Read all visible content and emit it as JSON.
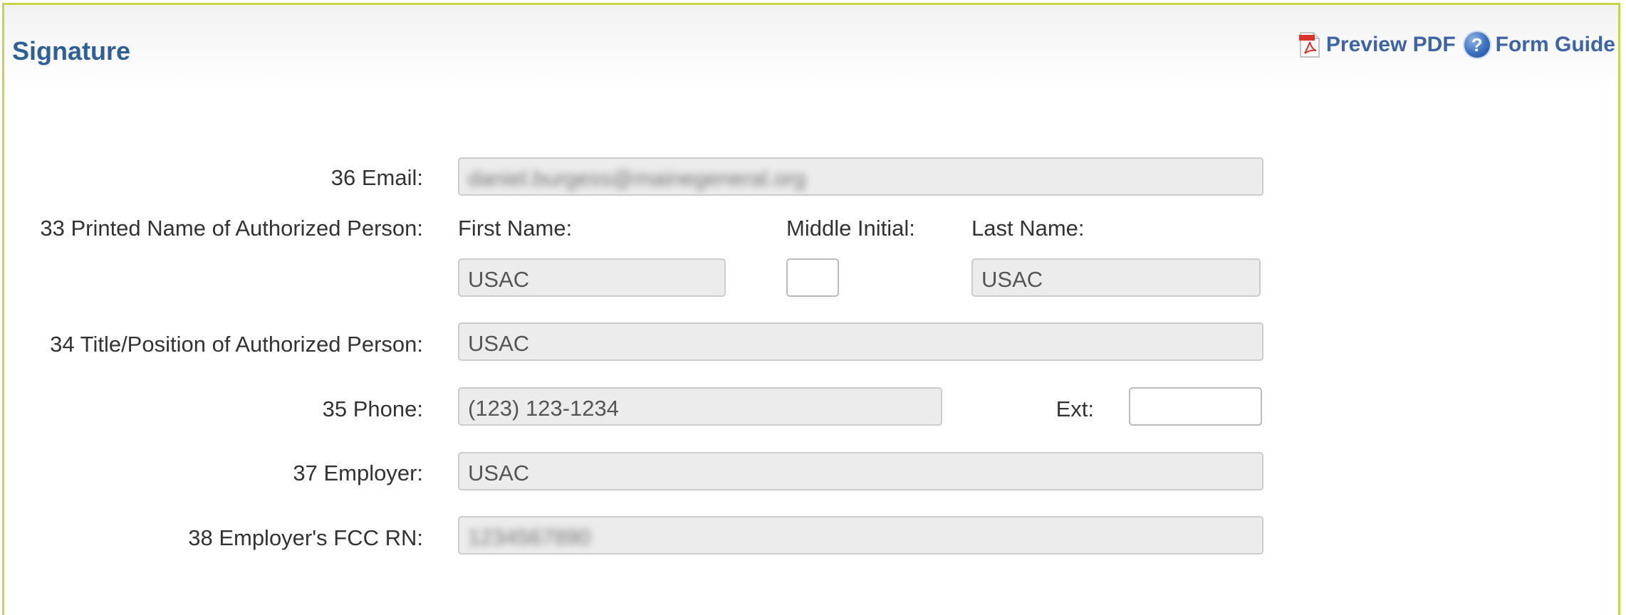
{
  "header": {
    "title": "Signature",
    "preview_pdf": "Preview PDF",
    "form_guide": "Form Guide",
    "help_icon_glyph": "?"
  },
  "form": {
    "email": {
      "label": "36 Email:",
      "value": "daniel.burgess@mainegeneral.org"
    },
    "printed_name": {
      "label": "33 Printed Name of Authorized Person:",
      "first_label": "First Name:",
      "middle_label": "Middle Initial:",
      "last_label": "Last Name:",
      "first_value": "USAC",
      "middle_value": "",
      "last_value": "USAC"
    },
    "title": {
      "label": "34 Title/Position of Authorized Person:",
      "value": "USAC"
    },
    "phone": {
      "label": "35 Phone:",
      "value": "(123) 123-1234",
      "ext_label": "Ext:",
      "ext_value": ""
    },
    "employer": {
      "label": "37 Employer:",
      "value": "USAC"
    },
    "fcc_rn": {
      "label": "38 Employer's FCC RN:",
      "value": "1234567890"
    }
  },
  "colors": {
    "border_accent": "#c8d44a",
    "title_color": "#2e5f97",
    "link_color": "#3e64a8",
    "field_bg": "#ececec"
  },
  "icons": [
    "pdf-icon",
    "help-icon"
  ]
}
